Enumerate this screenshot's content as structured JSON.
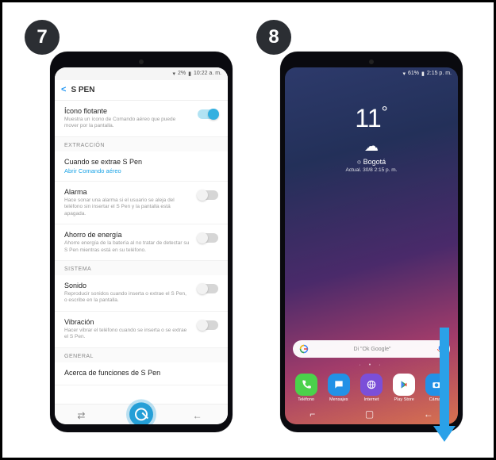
{
  "steps": {
    "s7": "7",
    "s8": "8"
  },
  "status_left": {
    "battery": "2%",
    "time": "10:22 a. m."
  },
  "status_right": {
    "battery": "61%",
    "time": "2:15 p. m."
  },
  "settings": {
    "header_title": "S PEN",
    "item_floating": {
      "title": "Ícono flotante",
      "desc": "Muestra un ícono de Comando aéreo que puede mover por la pantalla."
    },
    "section_extraction": "EXTRACCIÓN",
    "item_remove": {
      "title": "Cuando se extrae S Pen",
      "link": "Abrir Comando aéreo"
    },
    "item_alarm": {
      "title": "Alarma",
      "desc": "Hace sonar una alarma si el usuario se aleja del teléfono sin insertar el S Pen y la pantalla está apagada."
    },
    "item_power": {
      "title": "Ahorro de energía",
      "desc": "Ahorre energía de la batería al no tratar de detectar su S Pen mientras está en su teléfono."
    },
    "section_system": "SISTEMA",
    "item_sound": {
      "title": "Sonido",
      "desc": "Reproducir sonidos cuando inserta o extrae el S Pen, o escribe en la pantalla."
    },
    "item_vibration": {
      "title": "Vibración",
      "desc": "Hacer vibrar el teléfono cuando se inserta o se extrae el S Pen."
    },
    "section_general": "GENERAL",
    "item_about": {
      "title": "Acerca de funciones de S Pen"
    }
  },
  "home": {
    "temp": "11",
    "deg": "°",
    "city": "Bogotá",
    "updated": "Actual. 30/8 2:15 p. m.",
    "search_hint": "Di \"Ok Google\"",
    "dock": {
      "phone": "Teléfono",
      "messages": "Mensajes",
      "internet": "Internet",
      "playstore": "Play Store",
      "camera": "Cámara"
    }
  },
  "icons": {
    "wifi_glyph": "▾",
    "signal_glyph": "▮"
  }
}
